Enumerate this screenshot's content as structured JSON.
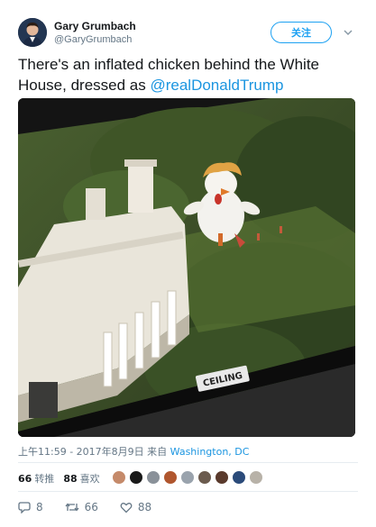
{
  "author": {
    "name": "Gary Grumbach",
    "handle": "@GaryGrumbach"
  },
  "follow_label": "关注",
  "tweet": {
    "text_before": "There's an inflated chicken behind the White House, dressed as ",
    "mention": "@realDonaldTrump"
  },
  "photo": {
    "sign_text": "CEILING"
  },
  "meta": {
    "timestamp": "上午11:59 - 2017年8月9日 来自",
    "location": "Washington, DC"
  },
  "stats": {
    "retweets_count": "66",
    "retweets_label": "转推",
    "likes_count": "88",
    "likes_label": "喜欢"
  },
  "liker_colors": [
    "#c58a6a",
    "#1a1a1a",
    "#8a9199",
    "#b0562e",
    "#9aa3ad",
    "#6b5b4e",
    "#5a3a2c",
    "#2b4b7a",
    "#b8b2a8"
  ],
  "actions": {
    "reply_count": "8",
    "retweet_count": "66",
    "like_count": "88"
  },
  "colors": {
    "accent": "#1da1f2",
    "link": "#1b95e0",
    "muted": "#657786"
  }
}
